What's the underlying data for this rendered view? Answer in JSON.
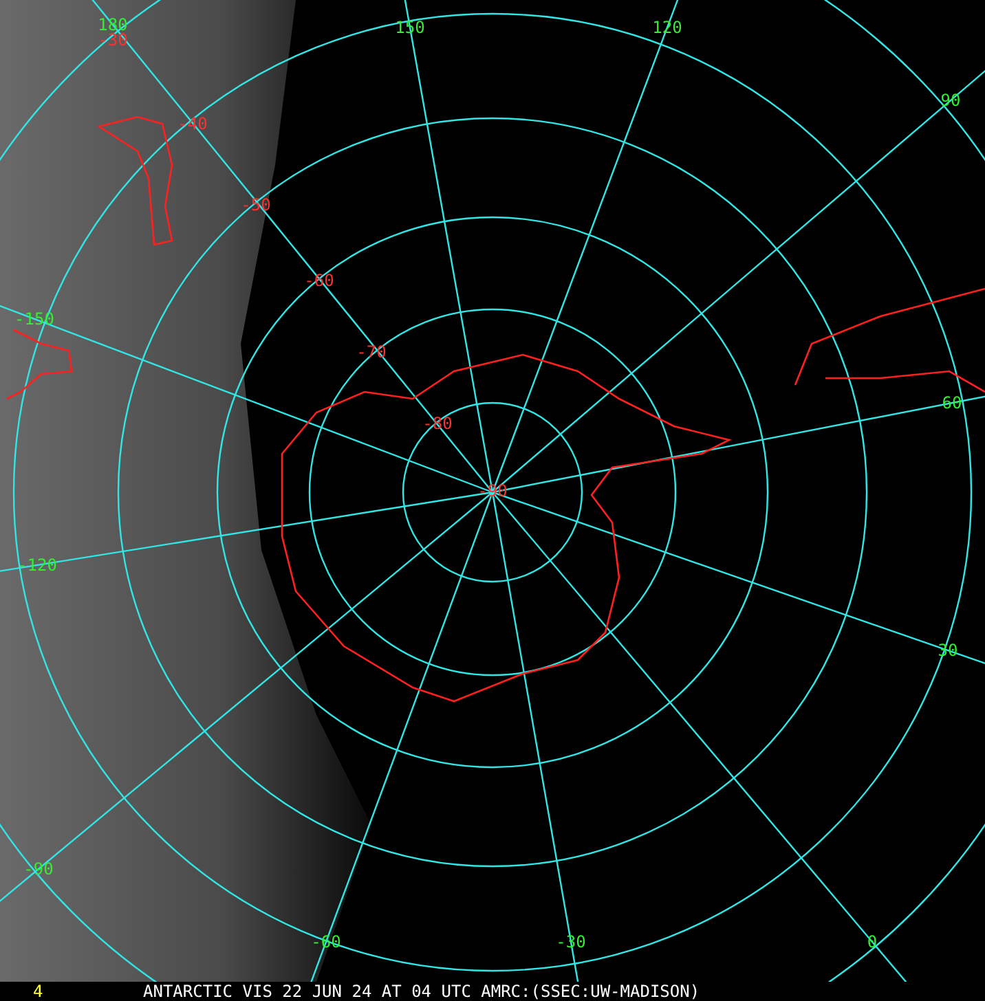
{
  "map": {
    "longitude_labels": [
      "180",
      "150",
      "120",
      "90",
      "-150",
      "60",
      "-120",
      "30",
      "-90",
      "-60",
      "-30",
      "0"
    ],
    "latitude_labels": [
      "-30",
      "-40",
      "-50",
      "-60",
      "-70",
      "-80",
      "-90"
    ]
  },
  "status_bar": {
    "frame_number": "4",
    "caption": "ANTARCTIC VIS 22 JUN 24 AT 04 UTC AMRC:(SSEC:UW-MADISON)"
  }
}
